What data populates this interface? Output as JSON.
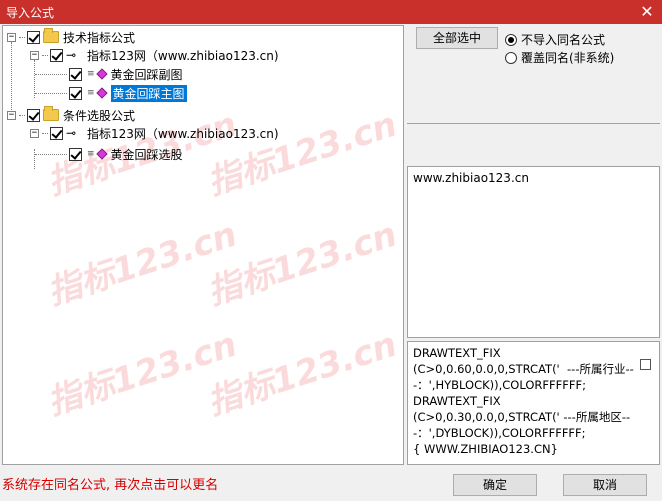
{
  "window": {
    "title": "导入公式",
    "close_glyph": "✕"
  },
  "tree": {
    "watermark": "指标123.cn",
    "nodes": [
      {
        "label": "技术指标公式",
        "level": 0,
        "expander": "−"
      },
      {
        "label": "指标123网（www.zhibiao123.cn)",
        "level": 1,
        "expander": "−"
      },
      {
        "label": "黄金回踩副图",
        "level": 2
      },
      {
        "label": "黄金回踩主图",
        "level": 2,
        "selected": true
      },
      {
        "label": "条件选股公式",
        "level": 0,
        "expander": "−"
      },
      {
        "label": "指标123网（www.zhibiao123.cn)",
        "level": 1,
        "expander": "−"
      },
      {
        "label": "黄金回踩选股",
        "level": 2
      }
    ]
  },
  "options": {
    "select_all_label": "全部选中",
    "radio_skip_label": "不导入同名公式",
    "radio_overwrite_label": "覆盖同名(非系统)"
  },
  "info": {
    "website": "www.zhibiao123.cn"
  },
  "code": {
    "text": "DRAWTEXT_FIX\n(C>0,0.60,0.0,0,STRCAT('  ---所属行业---：',HYBLOCK)),COLORFFFFFF;\nDRAWTEXT_FIX\n(C>0,0.30,0.0,0,STRCAT(' ---所属地区---：',DYBLOCK)),COLORFFFFFF;\n{ WWW.ZHIBIAO123.CN}"
  },
  "footer": {
    "status": "系统存在同名公式, 再次点击可以更名",
    "ok_label": "确定",
    "cancel_label": "取消"
  },
  "colors": {
    "titlebar": "#c9302c",
    "selection": "#0078d7",
    "status_text": "#d40000"
  }
}
